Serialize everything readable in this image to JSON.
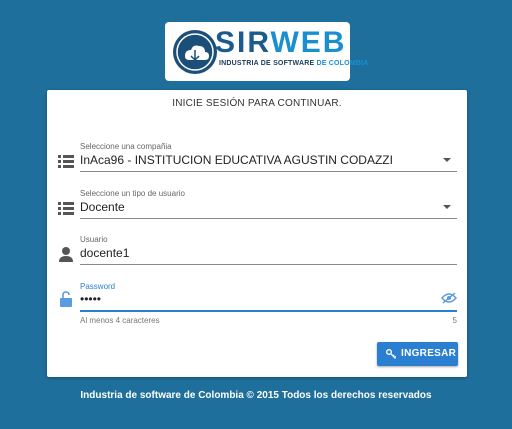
{
  "logo": {
    "name_part1": "SIR",
    "name_part2": "WEB",
    "tagline_main": "INDUSTRIA DE SOFTWARE ",
    "tagline_highlight": "DE COLOMBIA"
  },
  "login": {
    "title": "INICIE SESIÓN PARA CONTINUAR.",
    "company_label": "Seleccione una compañia",
    "company_value": "InAca96 - INSTITUCION EDUCATIVA AGUSTIN CODAZZI",
    "usertype_label": "Seleccione un tipo de usuario",
    "usertype_value": "Docente",
    "user_label": "Usuario",
    "user_value": "docente1",
    "password_label": "Password",
    "password_value": "•••••",
    "hint": "Al menos 4 caracteres",
    "char_count": "5",
    "submit_label": "INGRESAR"
  },
  "footer": {
    "text": "Industria de software de Colombia © 2015 Todos los derechos reservados"
  },
  "colors": {
    "background": "#1f6f9c",
    "accent": "#2b7fd1",
    "card": "#ffffff"
  },
  "icons": {
    "company": "list-icon",
    "usertype": "list-icon",
    "user": "person-icon",
    "password": "unlock-icon",
    "visibility": "eye-off-icon",
    "submit": "key-icon"
  }
}
